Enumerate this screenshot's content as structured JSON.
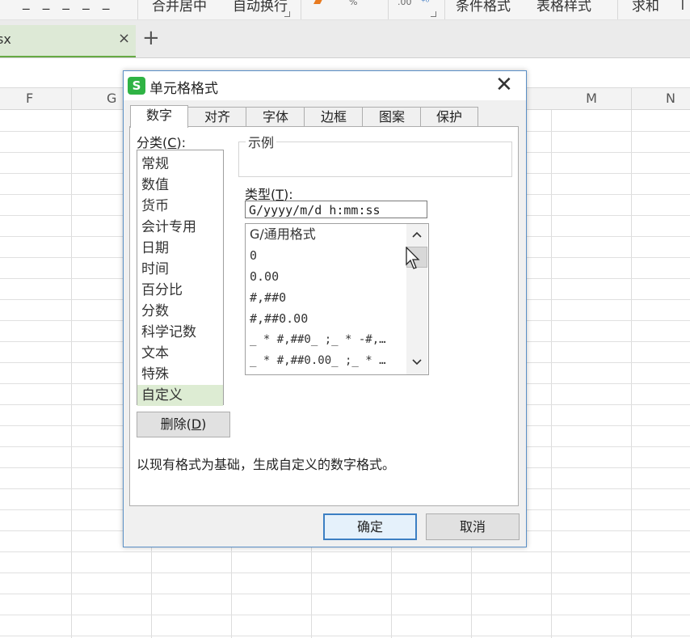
{
  "ribbon": {
    "merge_center": "合并居中",
    "auto_wrap": "自动换行",
    "percent": "%",
    "decimals": ".00",
    "cond_format": "条件格式",
    "table_style": "表格样式",
    "sum": "求和"
  },
  "tabbar": {
    "doc_tab_label": "sx",
    "close_glyph": "×",
    "add_glyph": "+"
  },
  "columns": [
    "F",
    "G",
    "M",
    "N"
  ],
  "dialog": {
    "title": "单元格格式",
    "app_icon": "S",
    "close_glyph": "✕",
    "tabs": [
      {
        "label": "数字",
        "active": true
      },
      {
        "label": "对齐",
        "active": false
      },
      {
        "label": "字体",
        "active": false
      },
      {
        "label": "边框",
        "active": false
      },
      {
        "label": "图案",
        "active": false
      },
      {
        "label": "保护",
        "active": false
      }
    ],
    "category_label_pre": "分类(",
    "category_label_key": "C",
    "category_label_post": "):",
    "categories": [
      "常规",
      "数值",
      "货币",
      "会计专用",
      "日期",
      "时间",
      "百分比",
      "分数",
      "科学记数",
      "文本",
      "特殊",
      "自定义"
    ],
    "selected_category": "自定义",
    "sample_label": "示例",
    "type_label_pre": "类型(",
    "type_label_key": "T",
    "type_label_post": "):",
    "type_value": "G/yyyy/m/d h:mm:ss",
    "formats": [
      "G/通用格式",
      "0",
      "0.00",
      "#,##0",
      "#,##0.00",
      "_ * #,##0_ ;_ * -#,…",
      "_ * #,##0.00_ ;_ * …"
    ],
    "delete_pre": "删除(",
    "delete_key": "D",
    "delete_post": ")",
    "description": "以现有格式为基础，生成自定义的数字格式。",
    "ok_label": "确定",
    "cancel_label": "取消"
  },
  "colors": {
    "accent_green": "#2fb344",
    "selection_green": "#ddecd3",
    "dialog_border": "#5a8fc6",
    "ok_border": "#3c7fc3"
  },
  "icons": {
    "app": "wps-spreadsheet-icon",
    "close": "close-icon",
    "scroll_up": "chevron-up-icon",
    "scroll_down": "chevron-down-icon",
    "cursor": "mouse-pointer-icon"
  }
}
